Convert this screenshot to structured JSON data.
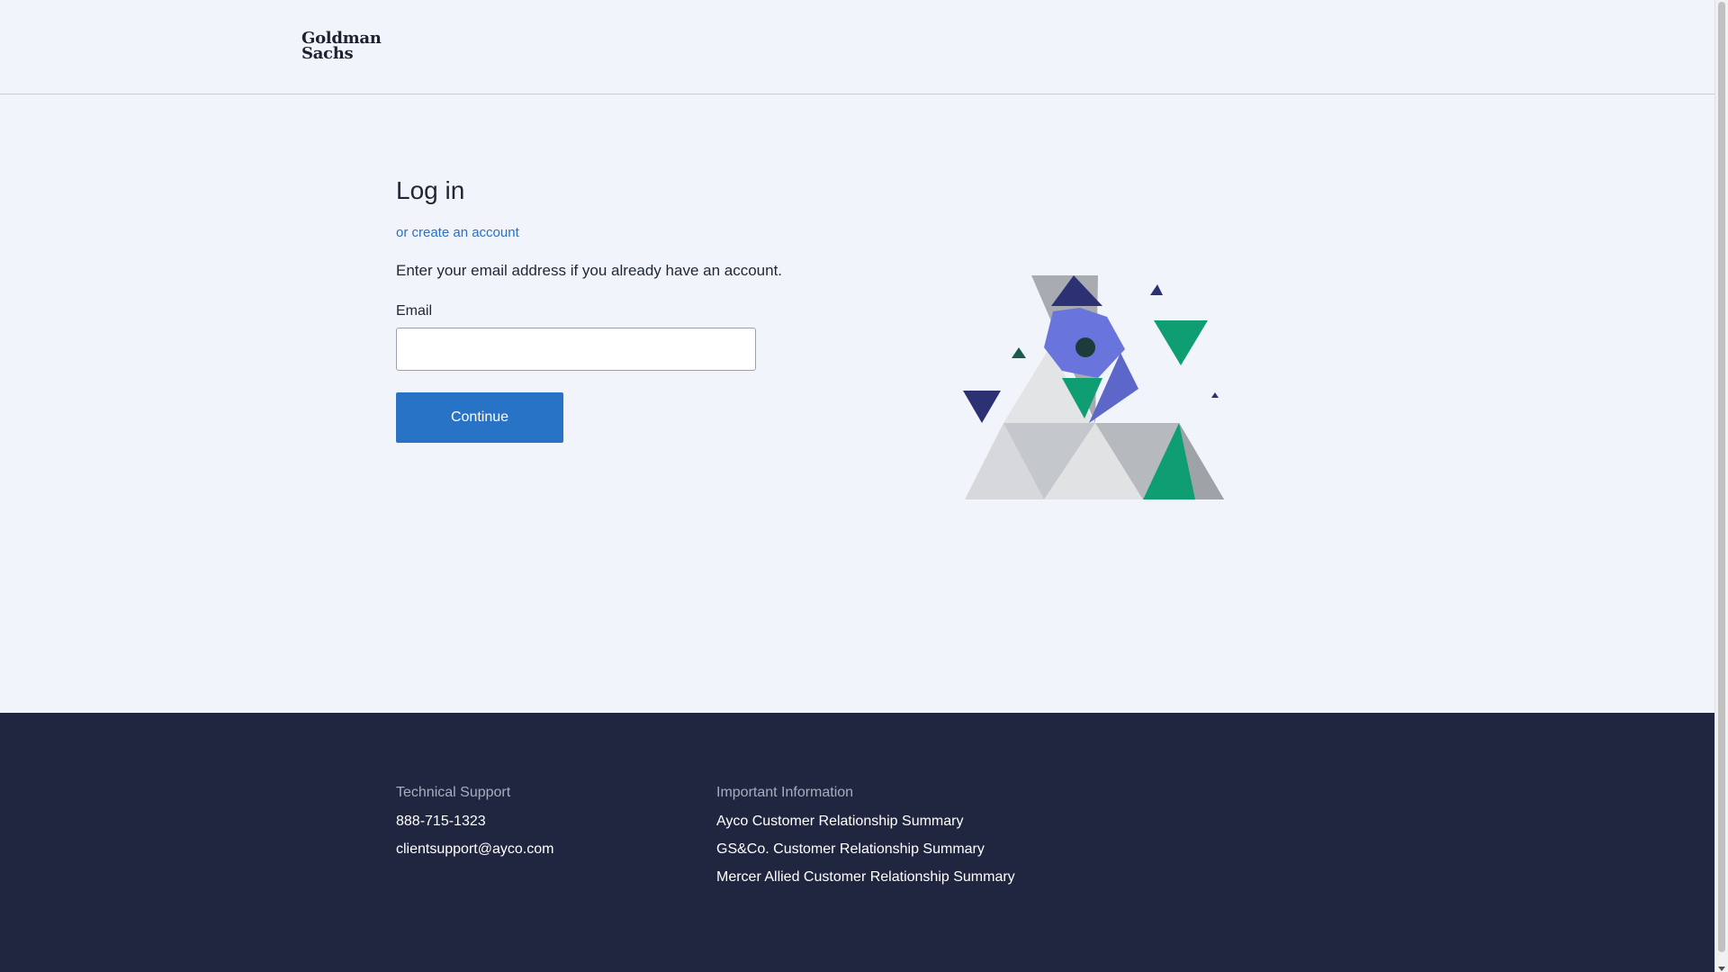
{
  "header": {
    "logo_line1": "Goldman",
    "logo_line2": "Sachs"
  },
  "login": {
    "title": "Log in",
    "create_account_link": "or create an account",
    "instructions": "Enter your email address if you already have an account.",
    "email_label": "Email",
    "email_value": "",
    "continue_label": "Continue"
  },
  "footer": {
    "support": {
      "heading": "Technical Support",
      "phone": "888-715-1323",
      "email": "clientsupport@ayco.com"
    },
    "info": {
      "heading": "Important Information",
      "links": [
        "Ayco Customer Relationship Summary",
        "GS&Co. Customer Relationship Summary",
        "Mercer Allied Customer Relationship Summary"
      ]
    }
  },
  "colors": {
    "accent": "#2973c7",
    "footer_bg": "#212640",
    "page_bg": "#f1f5fb",
    "illustration_green": "#0e9e72",
    "illustration_navy": "#2c3173",
    "illustration_purple": "#6a74dd"
  }
}
